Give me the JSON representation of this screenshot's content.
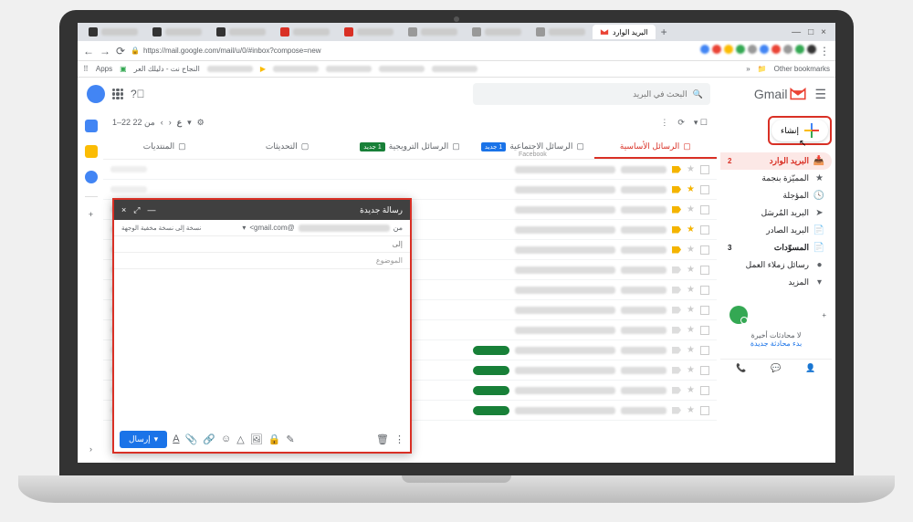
{
  "browser": {
    "active_tab": "البريد الوارد",
    "url": "https://mail.google.com/mail/u/0/#inbox?compose=new",
    "new_tab": "+",
    "bookmarks_label": "Other bookmarks",
    "apps_label": "Apps",
    "bm_item": "النجاح نت - دليلك العر"
  },
  "header": {
    "brand": "Gmail",
    "search_placeholder": "البحث في البريد"
  },
  "sidebar": {
    "compose": "إنشاء",
    "items": [
      {
        "icon": "inbox",
        "label": "البريد الوارد",
        "badge": "2",
        "active": true
      },
      {
        "icon": "star",
        "label": "المميّزة بنجمة"
      },
      {
        "icon": "clock",
        "label": "المؤجلة"
      },
      {
        "icon": "send",
        "label": "البريد المُرسَل"
      },
      {
        "icon": "file",
        "label": "البريد الصادر"
      },
      {
        "icon": "draft",
        "label": "المسوّدات",
        "badge": "3",
        "bold": true
      },
      {
        "icon": "label",
        "label": "رسائل زملاء العمل"
      },
      {
        "icon": "more",
        "label": "المزيد"
      }
    ],
    "no_chats": "لا محادثات أخيرة",
    "start_chat": "بدء محادثة جديدة"
  },
  "toolbar": {
    "count": "1–22 من 22",
    "lang": "ع"
  },
  "categories": [
    {
      "label": "الرسائل الأساسية",
      "active": true
    },
    {
      "label": "الرسائل الاجتماعية",
      "badge": "1 جديد",
      "sub": "Facebook"
    },
    {
      "label": "الرسائل الترويجية",
      "badge": "1 جديد",
      "green": true
    },
    {
      "label": "التحديثات"
    },
    {
      "label": "المنتديات"
    }
  ],
  "compose": {
    "title": "رسالة جديدة",
    "from_label": "من",
    "from_suffix": "@gmail.com>",
    "cc": "نسخة إلى نسخة مخفية الوجهة",
    "to_placeholder": "إلى",
    "subject": "الموضوع",
    "send": "إرسال"
  }
}
